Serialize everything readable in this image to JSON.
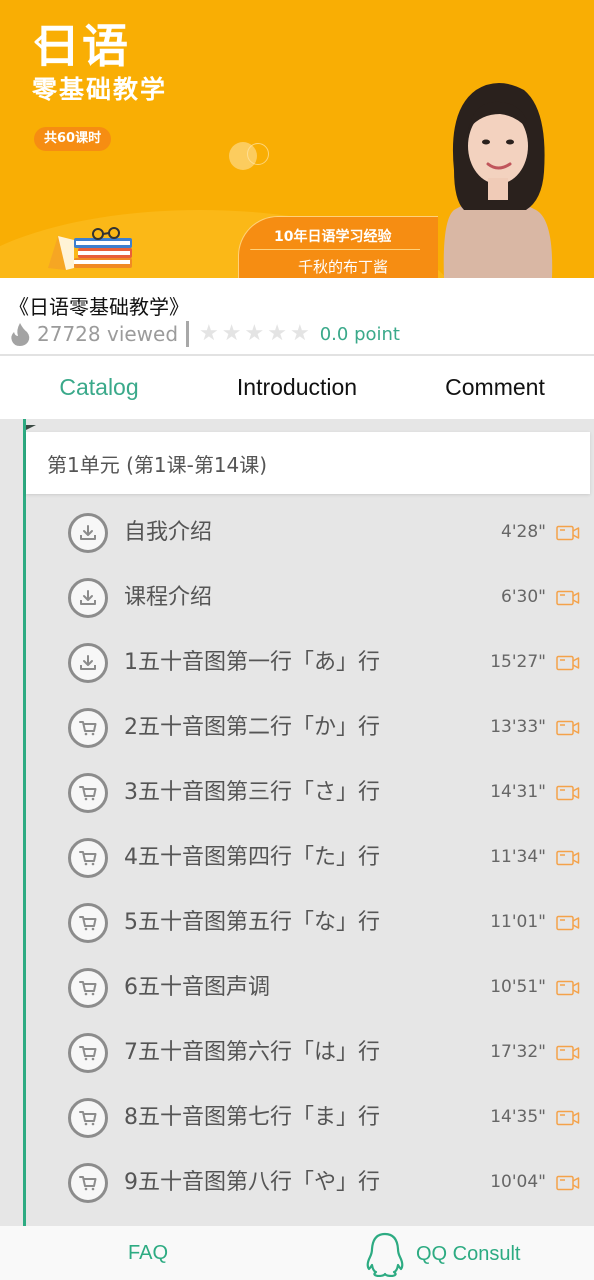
{
  "banner": {
    "title": "日语",
    "subtitle": "零基础教学",
    "hours_badge": "共60课时",
    "experience": "10年日语学习经验",
    "teacher": "千秋的布丁酱",
    "background_color": "#f9ae04",
    "accent_color": "#f68d12"
  },
  "course": {
    "title": "《日语零基础教学》",
    "views": "27728 viewed",
    "rating_stars": 0,
    "rating_max": 5,
    "score": "0.0 point"
  },
  "tabs": [
    {
      "label": "Catalog",
      "active": true
    },
    {
      "label": "Introduction",
      "active": false
    },
    {
      "label": "Comment",
      "active": false
    }
  ],
  "catalog": {
    "unit_header": "第1单元 (第1课-第14课)",
    "lessons": [
      {
        "title": "自我介绍",
        "duration": "4'28\"",
        "icon": "download-icon"
      },
      {
        "title": "课程介绍",
        "duration": "6'30\"",
        "icon": "download-icon"
      },
      {
        "title": "1五十音图第一行「あ」行",
        "duration": "15'27\"",
        "icon": "download-icon"
      },
      {
        "title": "2五十音图第二行「か」行",
        "duration": "13'33\"",
        "icon": "cart-icon"
      },
      {
        "title": "3五十音图第三行「さ」行",
        "duration": "14'31\"",
        "icon": "cart-icon"
      },
      {
        "title": "4五十音图第四行「た」行",
        "duration": "11'34\"",
        "icon": "cart-icon"
      },
      {
        "title": "5五十音图第五行「な」行",
        "duration": "11'01\"",
        "icon": "cart-icon"
      },
      {
        "title": "6五十音图声调",
        "duration": "10'51\"",
        "icon": "cart-icon"
      },
      {
        "title": "7五十音图第六行「は」行",
        "duration": "17'32\"",
        "icon": "cart-icon"
      },
      {
        "title": "8五十音图第七行「ま」行",
        "duration": "14'35\"",
        "icon": "cart-icon"
      },
      {
        "title": "9五十音图第八行「や」行",
        "duration": "10'04\"",
        "icon": "cart-icon"
      }
    ]
  },
  "bottom_bar": {
    "faq_label": "FAQ",
    "qq_label": "QQ Consult"
  },
  "colors": {
    "accent_green": "#2dab82",
    "video_orange": "#f4a24a"
  }
}
